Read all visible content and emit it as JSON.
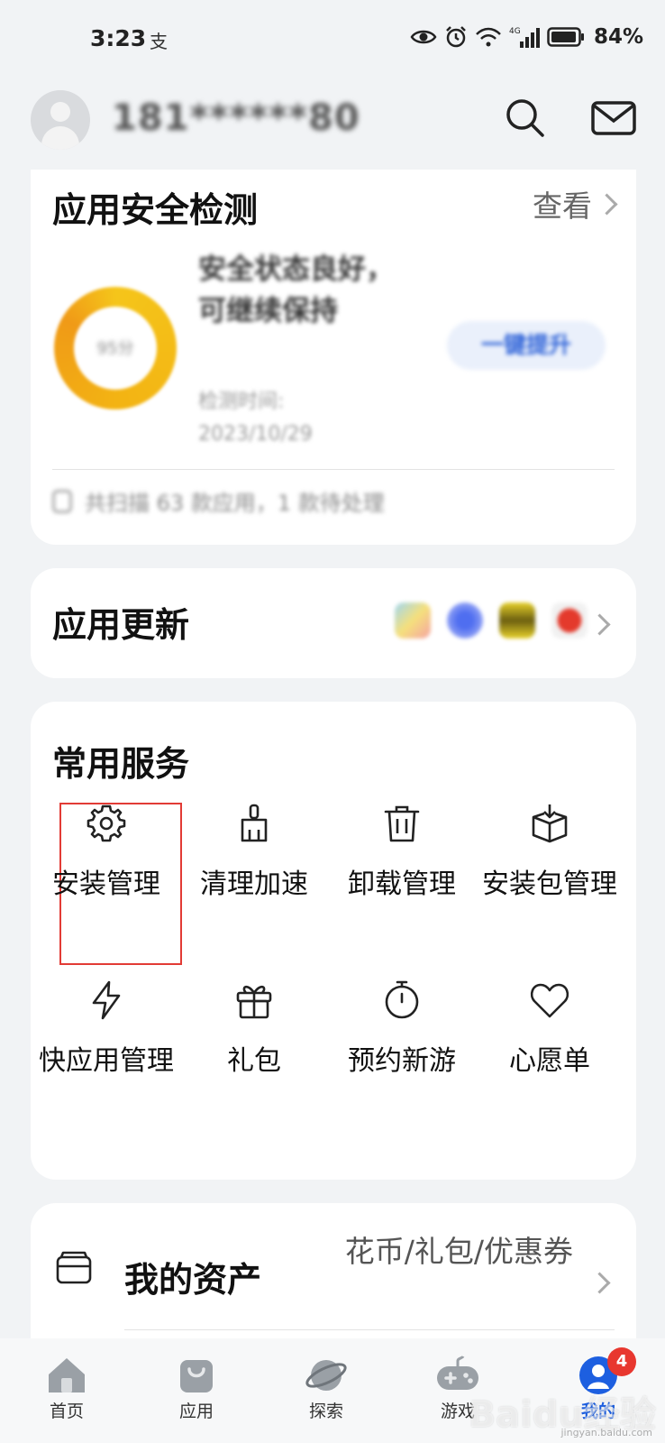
{
  "status_bar": {
    "time": "3:23",
    "notification_icon": "alipay-icon",
    "battery": "84%",
    "network": "4G"
  },
  "header": {
    "username": "181******80"
  },
  "security_card": {
    "title": "应用安全检测",
    "view_label": "查看",
    "score": "95分",
    "status_text": "安全状态良好，可继续保持",
    "check_time": "检测时间: 2023/10/29",
    "optimize_label": "一键提升",
    "footer_text": "共扫描 63 款应用，1 款待处理"
  },
  "update_card": {
    "title": "应用更新"
  },
  "services": {
    "title": "常用服务",
    "items": [
      {
        "label": "安装管理",
        "icon": "gear-icon"
      },
      {
        "label": "清理加速",
        "icon": "broom-icon"
      },
      {
        "label": "卸载管理",
        "icon": "trash-icon"
      },
      {
        "label": "安装包管理",
        "icon": "package-icon"
      },
      {
        "label": "快应用管理",
        "icon": "lightning-icon"
      },
      {
        "label": "礼包",
        "icon": "gift-icon"
      },
      {
        "label": "预约新游",
        "icon": "stopwatch-icon"
      },
      {
        "label": "心愿单",
        "icon": "heart-icon"
      }
    ]
  },
  "assets_card": {
    "title": "我的资产",
    "desc": "花币/礼包/优惠券"
  },
  "tabbar": {
    "tabs": [
      {
        "label": "首页"
      },
      {
        "label": "应用"
      },
      {
        "label": "探索"
      },
      {
        "label": "游戏"
      },
      {
        "label": "我的",
        "badge": "4"
      }
    ],
    "active_color": "#1d5fe0"
  },
  "watermark": {
    "text": "Baidu经验",
    "sub": "jingyan.baidu.com"
  }
}
